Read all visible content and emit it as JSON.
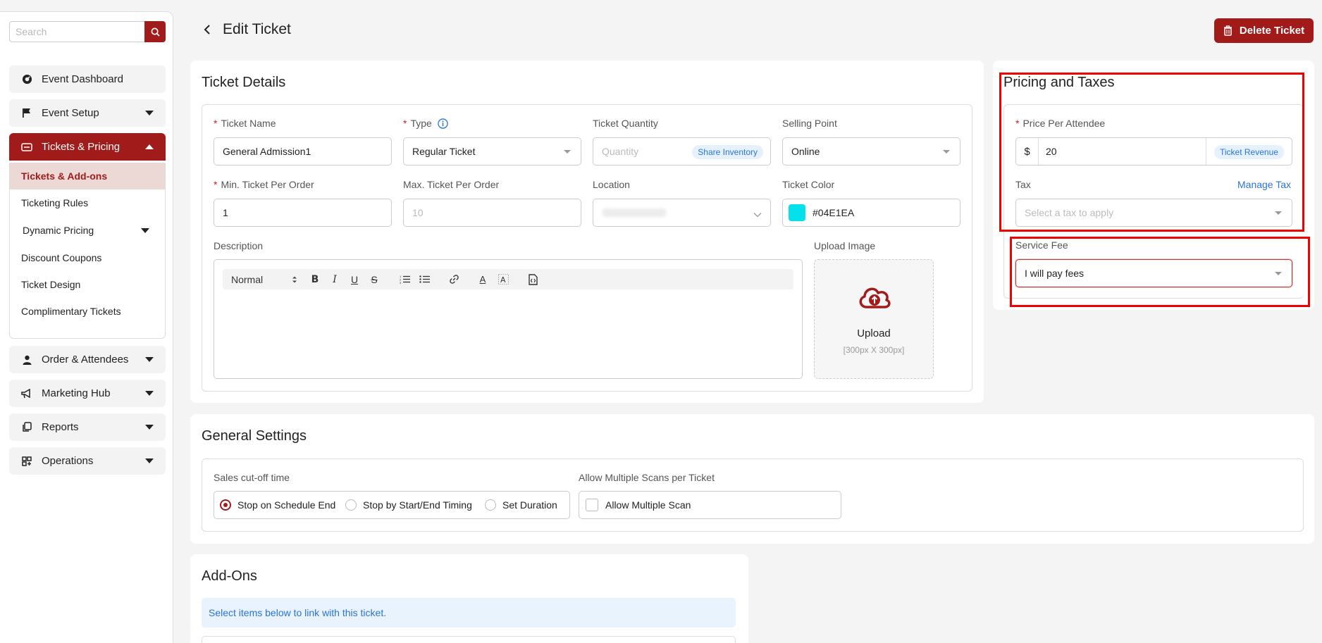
{
  "sidebar": {
    "search_placeholder": "Search",
    "items": [
      {
        "label": "Event Dashboard",
        "icon": "dashboard-icon"
      },
      {
        "label": "Event Setup",
        "icon": "flag-icon"
      },
      {
        "label": "Tickets & Pricing",
        "icon": "ticket-icon"
      },
      {
        "label": "Order & Attendees",
        "icon": "person-icon"
      },
      {
        "label": "Marketing Hub",
        "icon": "megaphone-icon"
      },
      {
        "label": "Reports",
        "icon": "reports-icon"
      },
      {
        "label": "Operations",
        "icon": "grid-icon"
      }
    ],
    "sub_items": [
      {
        "label": "Tickets & Add-ons"
      },
      {
        "label": "Ticketing Rules"
      },
      {
        "label": "Dynamic Pricing"
      },
      {
        "label": "Discount Coupons"
      },
      {
        "label": "Ticket Design"
      },
      {
        "label": "Complimentary Tickets"
      }
    ]
  },
  "header": {
    "title": "Edit Ticket",
    "delete_label": "Delete Ticket"
  },
  "ticket_details": {
    "title": "Ticket Details",
    "ticket_name_label": "Ticket Name",
    "ticket_name_value": "General Admission1",
    "type_label": "Type",
    "type_value": "Regular Ticket",
    "quantity_label": "Ticket Quantity",
    "quantity_placeholder": "Quantity",
    "share_inventory": "Share Inventory",
    "selling_point_label": "Selling Point",
    "selling_point_value": "Online",
    "min_label": "Min. Ticket Per Order",
    "min_value": "1",
    "max_label": "Max. Ticket Per Order",
    "max_placeholder": "10",
    "location_label": "Location",
    "color_label": "Ticket Color",
    "color_value": "#04E1EA",
    "description_label": "Description",
    "editor_format": "Normal",
    "upload_label": "Upload Image",
    "upload_text": "Upload",
    "upload_hint": "[300px X 300px]"
  },
  "pricing": {
    "title": "Pricing and Taxes",
    "price_label": "Price Per Attendee",
    "currency": "$",
    "price_value": "20",
    "revenue_pill": "Ticket Revenue",
    "tax_label": "Tax",
    "manage_tax": "Manage Tax",
    "tax_placeholder": "Select a tax to apply",
    "service_fee_label": "Service Fee",
    "service_fee_value": "I will pay fees"
  },
  "general_settings": {
    "title": "General Settings",
    "cutoff_label": "Sales cut-off time",
    "options": [
      "Stop on Schedule End",
      "Stop by Start/End Timing",
      "Set Duration"
    ],
    "selected_option": "Stop on Schedule End",
    "multi_scan_label": "Allow Multiple Scans per Ticket",
    "multi_scan_checkbox": "Allow Multiple Scan"
  },
  "addons": {
    "title": "Add-Ons",
    "info": "Select items below to link with this ticket."
  },
  "colors": {
    "brand": "#a21b1b",
    "ticket_color": "#04E1EA",
    "highlight": "#ee0000"
  }
}
